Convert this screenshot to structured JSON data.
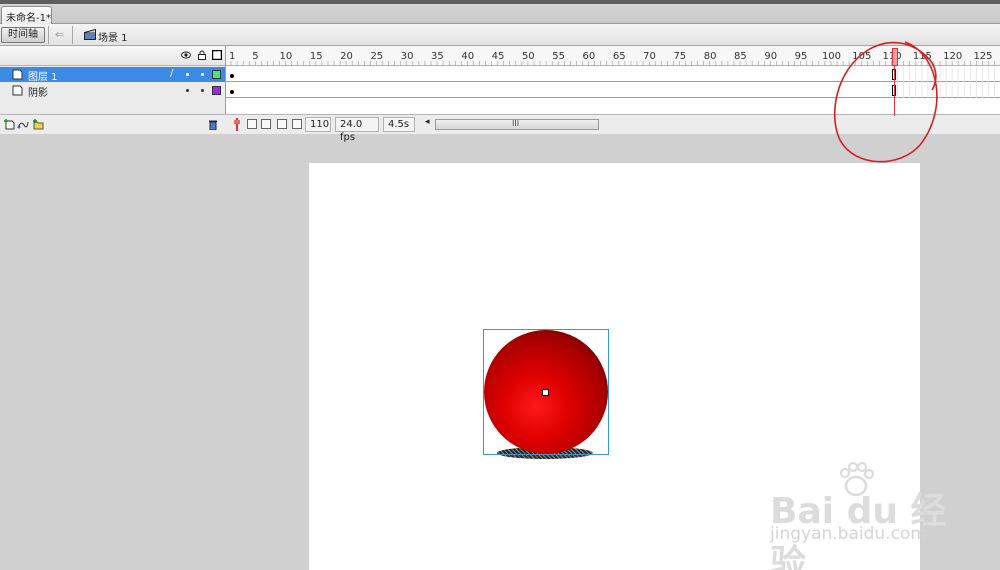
{
  "document": {
    "tab_title": "未命名-1*"
  },
  "scene_bar": {
    "timeline_button": "时间轴",
    "scene_name": "场景 1"
  },
  "timeline": {
    "layers": [
      {
        "name": "图层 1",
        "selected": true,
        "outline_color": "#3ee88a"
      },
      {
        "name": "阴影",
        "selected": false,
        "outline_color": "#9b2be0"
      }
    ],
    "ruler_labels": [
      "1",
      "5",
      "10",
      "15",
      "20",
      "25",
      "30",
      "35",
      "40",
      "45",
      "50",
      "55",
      "60",
      "65",
      "70",
      "75",
      "80",
      "85",
      "90",
      "95",
      "100",
      "105",
      "110",
      "115",
      "120",
      "125"
    ],
    "current_frame": "110",
    "frame_rate": "24.0 fps",
    "elapsed_time": "4.5s"
  },
  "stage": {
    "object": "red-gradient-ball",
    "ball_color": "#e00000",
    "shadow_color": "#222222"
  },
  "annotation": {
    "circle_color": "#d42020"
  },
  "watermark": {
    "logo_text": "Bai du 经验",
    "url_text": "jingyan.baidu.com"
  }
}
